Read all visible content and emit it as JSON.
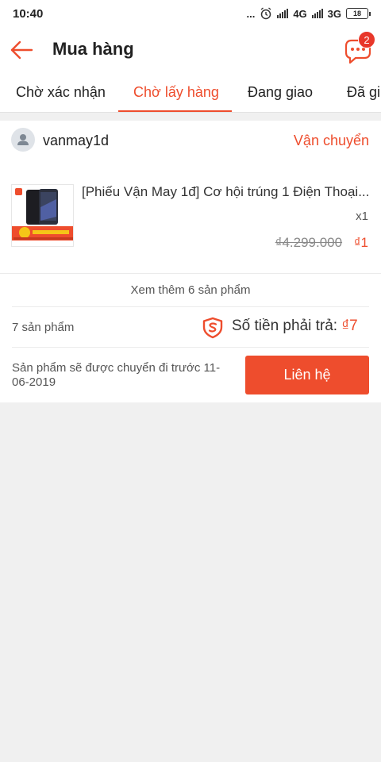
{
  "status_bar": {
    "time": "10:40",
    "dots": "...",
    "network_1": "4G",
    "network_2": "3G",
    "battery": "18"
  },
  "header": {
    "title": "Mua hàng",
    "chat_badge": "2"
  },
  "tabs": [
    {
      "label": "Chờ xác nhận",
      "active": false
    },
    {
      "label": "Chờ lấy hàng",
      "active": true
    },
    {
      "label": "Đang giao",
      "active": false
    },
    {
      "label": "Đã gi",
      "active": false
    }
  ],
  "order": {
    "shop_name": "vanmay1d",
    "shipping_status": "Vận chuyển",
    "product": {
      "name": "[Phiếu Vận May 1đ] Cơ hội trúng 1 Điện Thoại...",
      "quantity": "x1",
      "original_price": "₫4.299.000",
      "price": "₫1"
    },
    "see_more": "Xem thêm 6 sản phẩm",
    "item_count": "7 sản phẩm",
    "total_label": "Số tiền phải trả: ",
    "total_value": "₫7",
    "delivery_note": "Sản phẩm sẽ được chuyển đi trước 11-06-2019",
    "contact_button": "Liên hệ"
  },
  "colors": {
    "accent": "#ee4d2d",
    "badge": "#e8372a"
  },
  "icons": [
    "back-arrow-icon",
    "chat-icon",
    "avatar-icon",
    "shield-icon"
  ]
}
